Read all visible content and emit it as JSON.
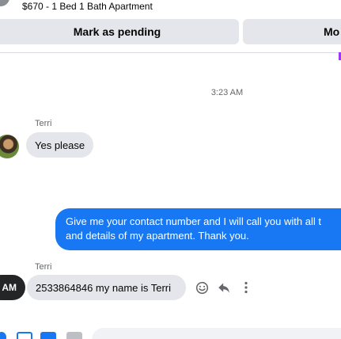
{
  "listing": {
    "title": "$670 - 1 Bed 1 Bath Apartment"
  },
  "actions": {
    "mark_pending": "Mark as pending",
    "more": "Mo"
  },
  "conversation": {
    "timestamp": "3:23 AM",
    "messages": [
      {
        "sender": "Terri",
        "direction": "incoming",
        "text": "Yes please"
      },
      {
        "sender": "",
        "direction": "outgoing",
        "lines": [
          "Give me your contact number and I will call you with all t",
          "and details of my apartment. Thank you."
        ]
      },
      {
        "sender": "Terri",
        "direction": "incoming",
        "text": "2533864846 my name is Terri",
        "hover_time": "AM"
      }
    ]
  },
  "colors": {
    "outgoing_bubble": "#1877f2",
    "incoming_bubble": "#e4e6eb",
    "button_bg": "#e4e6eb",
    "meta_text": "#65676b"
  },
  "message_actions": {
    "icons": [
      "smile-icon",
      "reply-icon",
      "more-vertical-icon"
    ]
  }
}
